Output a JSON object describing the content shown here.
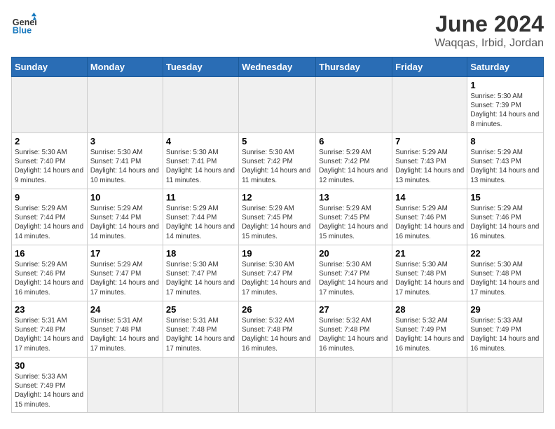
{
  "header": {
    "logo_general": "General",
    "logo_blue": "Blue",
    "month": "June 2024",
    "location": "Waqqas, Irbid, Jordan"
  },
  "weekdays": [
    "Sunday",
    "Monday",
    "Tuesday",
    "Wednesday",
    "Thursday",
    "Friday",
    "Saturday"
  ],
  "weeks": [
    [
      {
        "day": "",
        "empty": true
      },
      {
        "day": "",
        "empty": true
      },
      {
        "day": "",
        "empty": true
      },
      {
        "day": "",
        "empty": true
      },
      {
        "day": "",
        "empty": true
      },
      {
        "day": "",
        "empty": true
      },
      {
        "day": "1",
        "sunrise": "5:30 AM",
        "sunset": "7:39 PM",
        "daylight": "14 hours and 8 minutes."
      }
    ],
    [
      {
        "day": "2",
        "sunrise": "5:30 AM",
        "sunset": "7:40 PM",
        "daylight": "14 hours and 9 minutes."
      },
      {
        "day": "3",
        "sunrise": "5:30 AM",
        "sunset": "7:41 PM",
        "daylight": "14 hours and 10 minutes."
      },
      {
        "day": "4",
        "sunrise": "5:30 AM",
        "sunset": "7:41 PM",
        "daylight": "14 hours and 11 minutes."
      },
      {
        "day": "5",
        "sunrise": "5:30 AM",
        "sunset": "7:42 PM",
        "daylight": "14 hours and 11 minutes."
      },
      {
        "day": "6",
        "sunrise": "5:29 AM",
        "sunset": "7:42 PM",
        "daylight": "14 hours and 12 minutes."
      },
      {
        "day": "7",
        "sunrise": "5:29 AM",
        "sunset": "7:43 PM",
        "daylight": "14 hours and 13 minutes."
      },
      {
        "day": "8",
        "sunrise": "5:29 AM",
        "sunset": "7:43 PM",
        "daylight": "14 hours and 13 minutes."
      }
    ],
    [
      {
        "day": "9",
        "sunrise": "5:29 AM",
        "sunset": "7:44 PM",
        "daylight": "14 hours and 14 minutes."
      },
      {
        "day": "10",
        "sunrise": "5:29 AM",
        "sunset": "7:44 PM",
        "daylight": "14 hours and 14 minutes."
      },
      {
        "day": "11",
        "sunrise": "5:29 AM",
        "sunset": "7:44 PM",
        "daylight": "14 hours and 14 minutes."
      },
      {
        "day": "12",
        "sunrise": "5:29 AM",
        "sunset": "7:45 PM",
        "daylight": "14 hours and 15 minutes."
      },
      {
        "day": "13",
        "sunrise": "5:29 AM",
        "sunset": "7:45 PM",
        "daylight": "14 hours and 15 minutes."
      },
      {
        "day": "14",
        "sunrise": "5:29 AM",
        "sunset": "7:46 PM",
        "daylight": "14 hours and 16 minutes."
      },
      {
        "day": "15",
        "sunrise": "5:29 AM",
        "sunset": "7:46 PM",
        "daylight": "14 hours and 16 minutes."
      }
    ],
    [
      {
        "day": "16",
        "sunrise": "5:29 AM",
        "sunset": "7:46 PM",
        "daylight": "14 hours and 16 minutes."
      },
      {
        "day": "17",
        "sunrise": "5:29 AM",
        "sunset": "7:47 PM",
        "daylight": "14 hours and 17 minutes."
      },
      {
        "day": "18",
        "sunrise": "5:30 AM",
        "sunset": "7:47 PM",
        "daylight": "14 hours and 17 minutes."
      },
      {
        "day": "19",
        "sunrise": "5:30 AM",
        "sunset": "7:47 PM",
        "daylight": "14 hours and 17 minutes."
      },
      {
        "day": "20",
        "sunrise": "5:30 AM",
        "sunset": "7:47 PM",
        "daylight": "14 hours and 17 minutes."
      },
      {
        "day": "21",
        "sunrise": "5:30 AM",
        "sunset": "7:48 PM",
        "daylight": "14 hours and 17 minutes."
      },
      {
        "day": "22",
        "sunrise": "5:30 AM",
        "sunset": "7:48 PM",
        "daylight": "14 hours and 17 minutes."
      }
    ],
    [
      {
        "day": "23",
        "sunrise": "5:31 AM",
        "sunset": "7:48 PM",
        "daylight": "14 hours and 17 minutes."
      },
      {
        "day": "24",
        "sunrise": "5:31 AM",
        "sunset": "7:48 PM",
        "daylight": "14 hours and 17 minutes."
      },
      {
        "day": "25",
        "sunrise": "5:31 AM",
        "sunset": "7:48 PM",
        "daylight": "14 hours and 17 minutes."
      },
      {
        "day": "26",
        "sunrise": "5:32 AM",
        "sunset": "7:48 PM",
        "daylight": "14 hours and 16 minutes."
      },
      {
        "day": "27",
        "sunrise": "5:32 AM",
        "sunset": "7:48 PM",
        "daylight": "14 hours and 16 minutes."
      },
      {
        "day": "28",
        "sunrise": "5:32 AM",
        "sunset": "7:49 PM",
        "daylight": "14 hours and 16 minutes."
      },
      {
        "day": "29",
        "sunrise": "5:33 AM",
        "sunset": "7:49 PM",
        "daylight": "14 hours and 16 minutes."
      }
    ],
    [
      {
        "day": "30",
        "sunrise": "5:33 AM",
        "sunset": "7:49 PM",
        "daylight": "14 hours and 15 minutes."
      },
      {
        "day": "",
        "empty": true
      },
      {
        "day": "",
        "empty": true
      },
      {
        "day": "",
        "empty": true
      },
      {
        "day": "",
        "empty": true
      },
      {
        "day": "",
        "empty": true
      },
      {
        "day": "",
        "empty": true
      }
    ]
  ],
  "labels": {
    "sunrise_prefix": "Sunrise: ",
    "sunset_prefix": "Sunset: ",
    "daylight_prefix": "Daylight: "
  }
}
